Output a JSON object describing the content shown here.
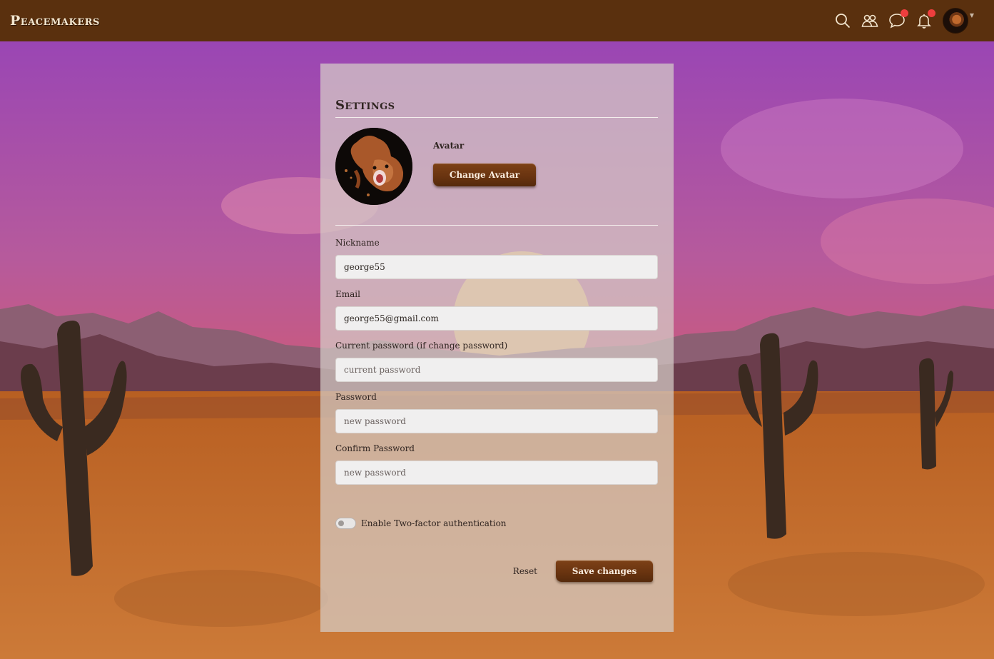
{
  "app": {
    "brand": "Peacemakers"
  },
  "nav": {
    "icons": [
      "search-icon",
      "friends-icon",
      "chat-icon",
      "bell-icon"
    ],
    "chat_has_notification": true,
    "bell_has_notification": true,
    "notification_color": "#ef3e3e"
  },
  "colors": {
    "topbar": "#5a300e",
    "button_wood": "#6a3410"
  },
  "settings": {
    "title": "Settings",
    "avatar_label": "Avatar",
    "change_avatar_label": "Change Avatar",
    "nickname_label": "Nickname",
    "nickname_value": "george55",
    "email_label": "Email",
    "email_value": "george55@gmail.com",
    "current_password_label": "Current password (if change password)",
    "current_password_placeholder": "current password",
    "password_label": "Password",
    "password_placeholder": "new password",
    "confirm_password_label": "Confirm Password",
    "confirm_password_placeholder": "new password",
    "twofa_label": "Enable Two-factor authentication",
    "twofa_enabled": false,
    "reset_label": "Reset",
    "save_label": "Save changes"
  }
}
